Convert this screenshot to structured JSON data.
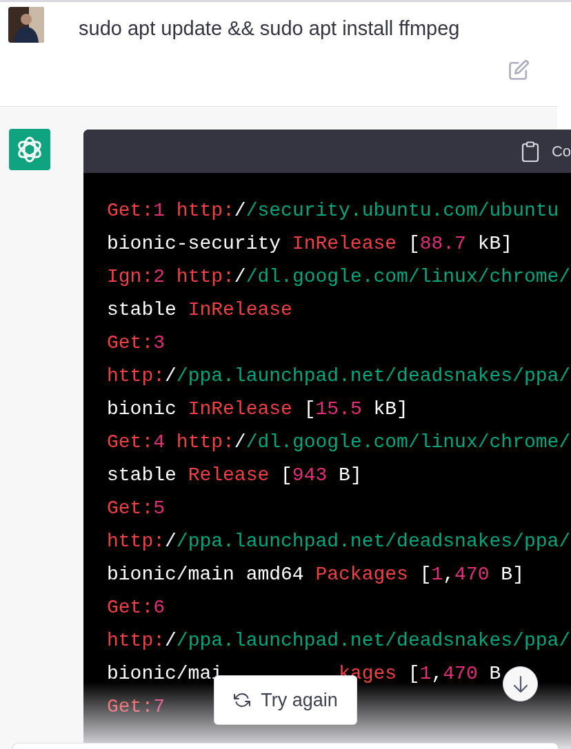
{
  "user_message": {
    "text": "sudo apt update && sudo apt install ffmpeg"
  },
  "code_block": {
    "copy_label": "Co",
    "lines": [
      {
        "tokens": [
          {
            "kind": "kw",
            "text": "Get:"
          },
          {
            "kind": "num",
            "text": "1"
          },
          {
            "kind": "kw",
            "text": " http:"
          },
          {
            "kind": "plain",
            "text": "/"
          },
          {
            "kind": "str",
            "text": "/security.ubuntu.com/ubuntu"
          }
        ]
      },
      {
        "tokens": [
          {
            "kind": "plain",
            "text": "bionic-security "
          },
          {
            "kind": "kw",
            "text": "InRelease"
          },
          {
            "kind": "plain",
            "text": " ["
          },
          {
            "kind": "num",
            "text": "88.7"
          },
          {
            "kind": "plain",
            "text": " kB]"
          }
        ]
      },
      {
        "tokens": [
          {
            "kind": "kw",
            "text": "Ign:"
          },
          {
            "kind": "num",
            "text": "2"
          },
          {
            "kind": "kw",
            "text": " http:"
          },
          {
            "kind": "plain",
            "text": "/"
          },
          {
            "kind": "str",
            "text": "/dl.google.com/linux/chrome/"
          }
        ]
      },
      {
        "tokens": [
          {
            "kind": "plain",
            "text": "stable "
          },
          {
            "kind": "kw",
            "text": "InRelease"
          }
        ]
      },
      {
        "tokens": [
          {
            "kind": "kw",
            "text": "Get:"
          },
          {
            "kind": "num",
            "text": "3"
          }
        ]
      },
      {
        "tokens": [
          {
            "kind": "kw",
            "text": "http:"
          },
          {
            "kind": "plain",
            "text": "/"
          },
          {
            "kind": "str",
            "text": "/ppa.launchpad.net/deadsnakes/ppa/"
          }
        ]
      },
      {
        "tokens": [
          {
            "kind": "plain",
            "text": "bionic "
          },
          {
            "kind": "kw",
            "text": "InRelease"
          },
          {
            "kind": "plain",
            "text": " ["
          },
          {
            "kind": "num",
            "text": "15.5"
          },
          {
            "kind": "plain",
            "text": " kB]"
          }
        ]
      },
      {
        "tokens": [
          {
            "kind": "kw",
            "text": "Get:"
          },
          {
            "kind": "num",
            "text": "4"
          },
          {
            "kind": "kw",
            "text": " http:"
          },
          {
            "kind": "plain",
            "text": "/"
          },
          {
            "kind": "str",
            "text": "/dl.google.com/linux/chrome/"
          }
        ]
      },
      {
        "tokens": [
          {
            "kind": "plain",
            "text": "stable "
          },
          {
            "kind": "kw",
            "text": "Release"
          },
          {
            "kind": "plain",
            "text": " ["
          },
          {
            "kind": "num",
            "text": "943"
          },
          {
            "kind": "plain",
            "text": " B]"
          }
        ]
      },
      {
        "tokens": [
          {
            "kind": "kw",
            "text": "Get:"
          },
          {
            "kind": "num",
            "text": "5"
          }
        ]
      },
      {
        "tokens": [
          {
            "kind": "kw",
            "text": "http:"
          },
          {
            "kind": "plain",
            "text": "/"
          },
          {
            "kind": "str",
            "text": "/ppa.launchpad.net/deadsnakes/ppa/"
          }
        ]
      },
      {
        "tokens": [
          {
            "kind": "plain",
            "text": "bionic/main amd64 "
          },
          {
            "kind": "kw",
            "text": "Packages"
          },
          {
            "kind": "plain",
            "text": " ["
          },
          {
            "kind": "num",
            "text": "1"
          },
          {
            "kind": "plain",
            "text": ","
          },
          {
            "kind": "num",
            "text": "470"
          },
          {
            "kind": "plain",
            "text": " B]"
          }
        ]
      },
      {
        "tokens": [
          {
            "kind": "kw",
            "text": "Get:"
          },
          {
            "kind": "num",
            "text": "6"
          }
        ]
      },
      {
        "tokens": [
          {
            "kind": "kw",
            "text": "http:"
          },
          {
            "kind": "plain",
            "text": "/"
          },
          {
            "kind": "str",
            "text": "/ppa.launchpad.net/deadsnakes/ppa/"
          }
        ]
      },
      {
        "tokens": [
          {
            "kind": "plain",
            "text": "bionic/mai"
          },
          {
            "kind": "gap"
          },
          {
            "kind": "kw",
            "text": "kages"
          },
          {
            "kind": "plain",
            "text": " ["
          },
          {
            "kind": "num",
            "text": "1"
          },
          {
            "kind": "plain",
            "text": ","
          },
          {
            "kind": "num",
            "text": "470"
          },
          {
            "kind": "plain",
            "text": " B"
          }
        ]
      },
      {
        "tokens": [
          {
            "kind": "kw",
            "text": "Get:"
          },
          {
            "kind": "num",
            "text": "7"
          }
        ]
      }
    ]
  },
  "try_again_button": {
    "label": "Try again"
  }
}
